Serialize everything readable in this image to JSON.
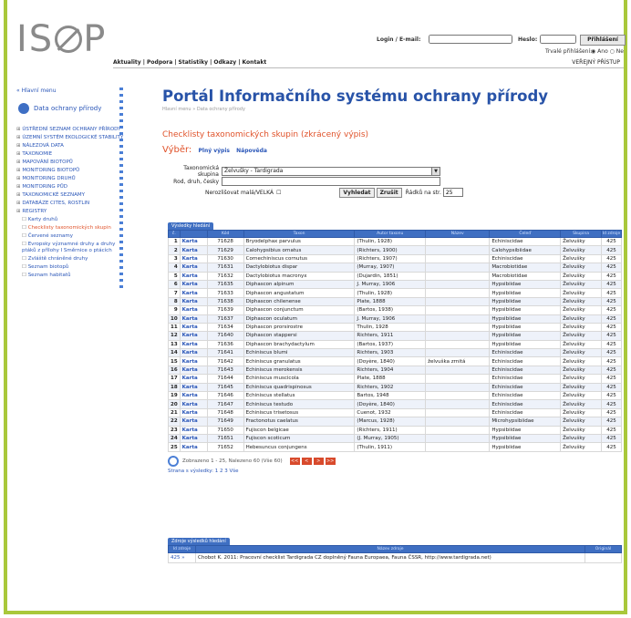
{
  "header": {
    "logo_text": "ISOP",
    "login_label": "Login / E-mail:",
    "password_label": "Heslo:",
    "login_button": "Přihlášení",
    "remember_label": "Trvalé přihlášení:",
    "remember_yes": "Ano",
    "remember_no": "Ne",
    "public_access": "VEŘEJNÝ PŘÍSTUP"
  },
  "nav": [
    "Aktuality",
    "Podpora",
    "Statistiky",
    "Odkazy",
    "Kontakt"
  ],
  "sidebar": {
    "home": "« Hlavní menu",
    "db_title": "Data ochrany přírody",
    "items": [
      "Ústřední seznam ochrany přírody",
      "Územní systém ekologické stability",
      "Nálezová data",
      "Taxonomie",
      "Mapování biotopů",
      "Monitoring biotopů",
      "Monitoring druhů",
      "Monitoring půd",
      "Taxonomické seznamy",
      "Databáze CITES, ROSTLIN",
      "Registry"
    ],
    "subitems": [
      "Karty druhů",
      "Checklisty taxonomických skupin",
      "Červené seznamy",
      "Evropsky významné druhy a druhy ptáků z přílohy I Směrnice o ptácích",
      "Zvláště chráněné druhy",
      "Seznam biotopů",
      "Seznam habitatů"
    ],
    "active_subitem_index": 1
  },
  "main": {
    "title": "Portál Informačního systému ochrany přírody",
    "breadcrumb": "Hlavní menu » Data ochrany přírody",
    "section_title": "Checklisty taxonomických skupin (zkrácený výpis)",
    "vyber_label": "Výběr:",
    "vyber_links": [
      "Plný výpis",
      "Nápověda"
    ]
  },
  "filter": {
    "group_label": "Taxonomická skupina",
    "group_value": "Želvušky - Tardigrada",
    "search_label": "Rod, druh, česky",
    "search_value": "",
    "uppercase_label": "Nerozlišovat malá/VELKÁ",
    "search_button": "Vyhledat",
    "clear_button": "Zrušit",
    "rows_label": "Řádků na str.",
    "rows_value": "25"
  },
  "results": {
    "tab_label": "Výsledky hledání",
    "columns": [
      "č.",
      "",
      "Kód",
      "Taxon",
      "Autor taxonu",
      "Název",
      "Čeleď",
      "Skupina",
      "Id zdroje"
    ],
    "rows": [
      [
        "1",
        "Karta",
        "71628",
        "Bryodelphax parvulus",
        "(Thulin, 1928)",
        "",
        "Echiniscidae",
        "Želvušky",
        "425"
      ],
      [
        "2",
        "Karta",
        "71629",
        "Calohypsibius ornatus",
        "(Richters, 1900)",
        "",
        "Calohypsibiidae",
        "Želvušky",
        "425"
      ],
      [
        "3",
        "Karta",
        "71630",
        "Cornechiniscus cornutus",
        "(Richters, 1907)",
        "",
        "Echiniscidae",
        "Želvušky",
        "425"
      ],
      [
        "4",
        "Karta",
        "71631",
        "Dactylobiotus dispar",
        "(Murray, 1907)",
        "",
        "Macrobiotidae",
        "Želvušky",
        "425"
      ],
      [
        "5",
        "Karta",
        "71632",
        "Dactylobiotus macronyx",
        "(Dujardin, 1851)",
        "",
        "Macrobiotidae",
        "Želvušky",
        "425"
      ],
      [
        "6",
        "Karta",
        "71635",
        "Diphascon alpinum",
        "J. Murray, 1906",
        "",
        "Hypsibiidae",
        "Želvušky",
        "425"
      ],
      [
        "7",
        "Karta",
        "71633",
        "Diphascon angustatum",
        "(Thulin, 1928)",
        "",
        "Hypsibiidae",
        "Želvušky",
        "425"
      ],
      [
        "8",
        "Karta",
        "71638",
        "Diphascon chilenense",
        "Plate, 1888",
        "",
        "Hypsibiidae",
        "Želvušky",
        "425"
      ],
      [
        "9",
        "Karta",
        "71639",
        "Diphascon conjunctum",
        "(Bartos, 1938)",
        "",
        "Hypsibiidae",
        "Želvušky",
        "425"
      ],
      [
        "10",
        "Karta",
        "71637",
        "Diphascon oculatum",
        "J. Murray, 1906",
        "",
        "Hypsibiidae",
        "Želvušky",
        "425"
      ],
      [
        "11",
        "Karta",
        "71634",
        "Diphascon prorsirostre",
        "Thulin, 1928",
        "",
        "Hypsibiidae",
        "Želvušky",
        "425"
      ],
      [
        "12",
        "Karta",
        "71640",
        "Diphascon stappersi",
        "Richters, 1911",
        "",
        "Hypsibiidae",
        "Želvušky",
        "425"
      ],
      [
        "13",
        "Karta",
        "71636",
        "Diphascon brachydactylum",
        "(Bartos, 1937)",
        "",
        "Hypsibiidae",
        "Želvušky",
        "425"
      ],
      [
        "14",
        "Karta",
        "71641",
        "Echiniscus blumi",
        "Richters, 1903",
        "",
        "Echiniscidae",
        "Želvušky",
        "425"
      ],
      [
        "15",
        "Karta",
        "71642",
        "Echiniscus granulatus",
        "(Doyère, 1840)",
        "želvuška zrnitá",
        "Echiniscidae",
        "Želvušky",
        "425"
      ],
      [
        "16",
        "Karta",
        "71643",
        "Echiniscus merokensis",
        "Richters, 1904",
        "",
        "Echiniscidae",
        "Želvušky",
        "425"
      ],
      [
        "17",
        "Karta",
        "71644",
        "Echiniscus muscicola",
        "Plate, 1888",
        "",
        "Echiniscidae",
        "Želvušky",
        "425"
      ],
      [
        "18",
        "Karta",
        "71645",
        "Echiniscus quadrispinosus",
        "Richters, 1902",
        "",
        "Echiniscidae",
        "Želvušky",
        "425"
      ],
      [
        "19",
        "Karta",
        "71646",
        "Echiniscus stellatus",
        "Bartos, 1948",
        "",
        "Echiniscidae",
        "Želvušky",
        "425"
      ],
      [
        "20",
        "Karta",
        "71647",
        "Echiniscus testudo",
        "(Doyère, 1840)",
        "",
        "Echiniscidae",
        "Želvušky",
        "425"
      ],
      [
        "21",
        "Karta",
        "71648",
        "Echiniscus trisetosus",
        "Cuenot, 1932",
        "",
        "Echiniscidae",
        "Želvušky",
        "425"
      ],
      [
        "22",
        "Karta",
        "71649",
        "Fractonotus caelatus",
        "(Marcus, 1928)",
        "",
        "Microhypsibiidae",
        "Želvušky",
        "425"
      ],
      [
        "23",
        "Karta",
        "71650",
        "Fujiscon belgicae",
        "(Richters, 1911)",
        "",
        "Hypsibiidae",
        "Želvušky",
        "425"
      ],
      [
        "24",
        "Karta",
        "71651",
        "Fujiscon scoticum",
        "(J. Murray, 1905)",
        "",
        "Hypsibiidae",
        "Želvušky",
        "425"
      ],
      [
        "25",
        "Karta",
        "71652",
        "Hebesuncus conjungens",
        "(Thulin, 1911)",
        "",
        "Hypsibiidae",
        "Želvušky",
        "425"
      ]
    ],
    "pager_text": "Zobrazeno 1 - 25, Nalezeno 60 (Vše 60)",
    "pager_buttons": [
      "<<",
      "<",
      ">",
      ">>"
    ],
    "pages_text": "Strana s výsledky: 1 2 3 Vše"
  },
  "sources": {
    "tab_label": "Zdroje výsledků hledání",
    "columns": [
      "Id zdroje",
      "Název zdroje",
      "Originál"
    ],
    "rows": [
      [
        "425 »",
        "Chobot K. 2011: Pracovní checklist Tardigrada CZ doplněný Fauna Europaea, Fauna ČSSR, http://www.tardigrada.net)",
        ""
      ]
    ]
  },
  "colors": {
    "frame": "#a9c83b",
    "accent_orange": "#e0532b",
    "link_blue": "#2a56b8",
    "table_header": "#3f6fc2"
  }
}
